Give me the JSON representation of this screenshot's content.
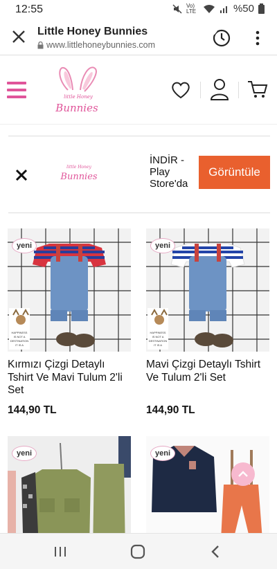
{
  "status": {
    "time": "12:55",
    "network": "Vo) LTE",
    "battery": "%50"
  },
  "tab": {
    "title": "Little Honey Bunnies",
    "url": "www.littlehoneybunnies.com"
  },
  "site": {
    "logo_top": "little Honey",
    "logo_bottom": "Bunnies"
  },
  "banner": {
    "text_line1": "İNDİR -",
    "text_line2": "Play",
    "text_line3": "Store'da",
    "button": "Görüntüle",
    "button_color": "#e9602e"
  },
  "products": [
    {
      "badge": "yeni",
      "name": "Kırmızı Çizgi Detaylı Tshirt Ve Mavi Tulum 2'li Set",
      "price": "144,90 TL"
    },
    {
      "badge": "yeni",
      "name": "Mavi Çizgi Detaylı Tshirt Ve Tulum 2'li Set",
      "price": "144,90 TL"
    },
    {
      "badge": "yeni"
    },
    {
      "badge": "yeni"
    }
  ],
  "colors": {
    "accent_pink": "#e0559a",
    "cta_orange": "#e9602e"
  }
}
